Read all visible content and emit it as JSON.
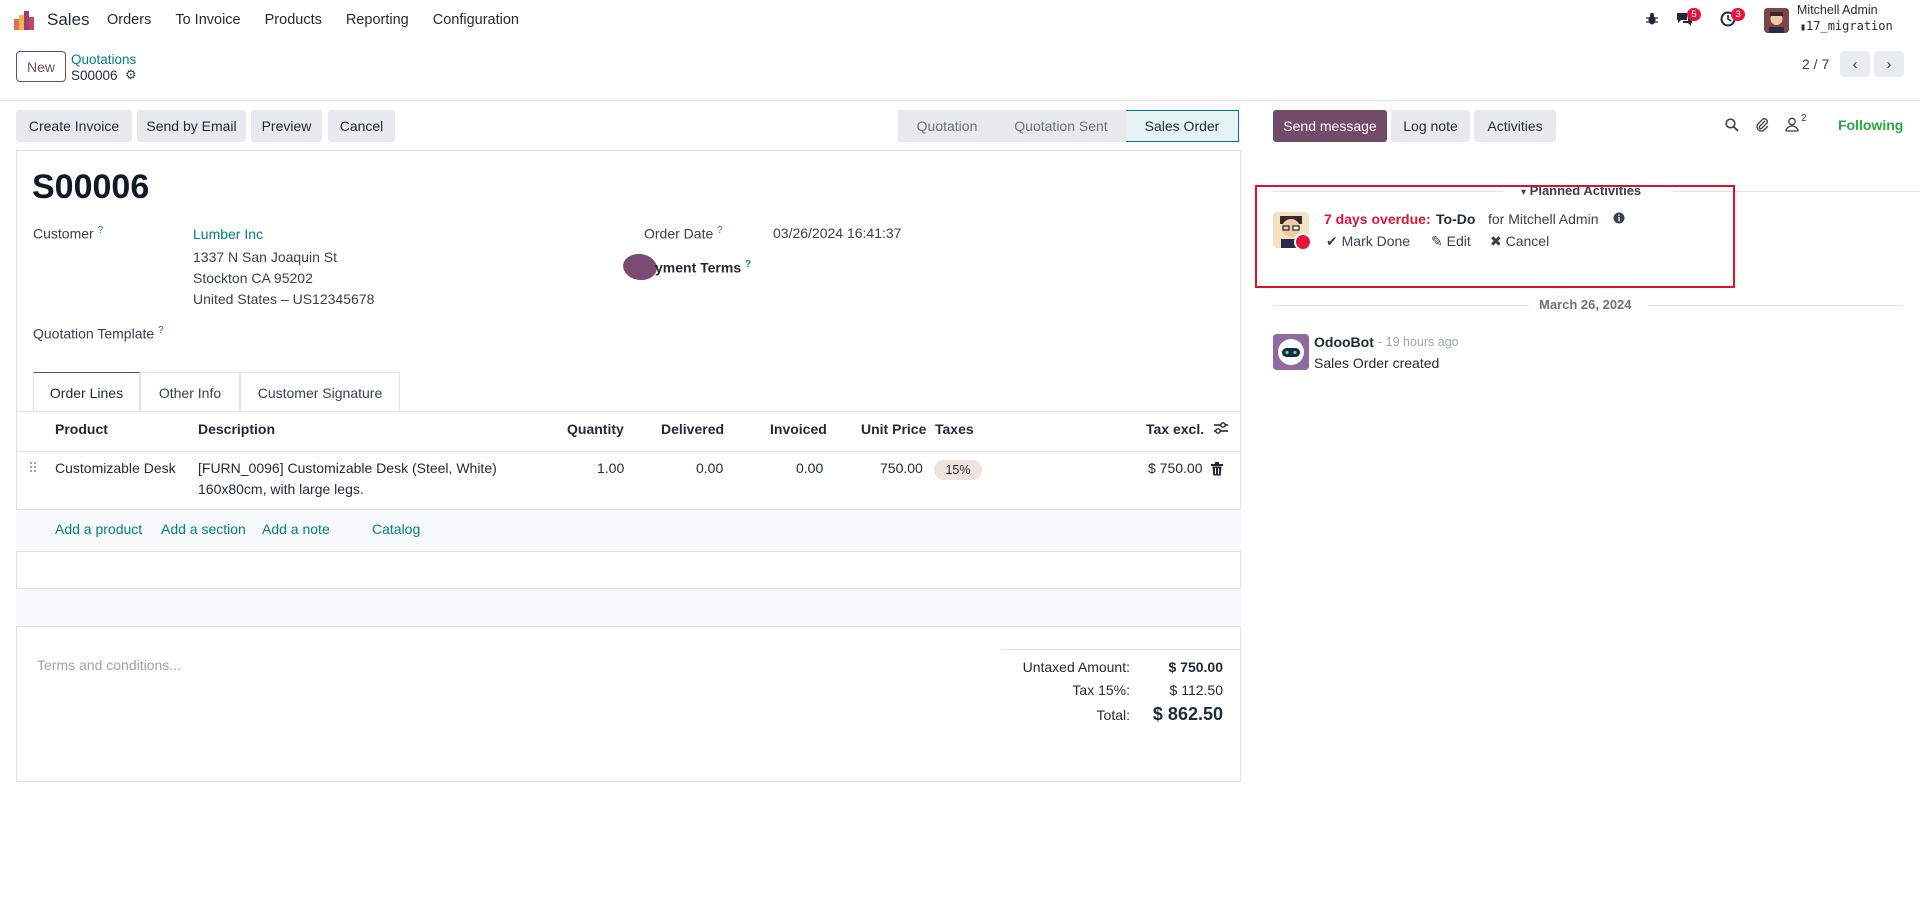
{
  "navbar": {
    "app_name": "Sales",
    "menu": [
      "Orders",
      "To Invoice",
      "Products",
      "Reporting",
      "Configuration"
    ],
    "messages_count": "5",
    "activities_count": "3",
    "user_name": "Mitchell Admin",
    "db_name": "17_migration"
  },
  "control": {
    "new_label": "New",
    "breadcrumb_parent": "Quotations",
    "breadcrumb_current": "S00006",
    "pager": "2 / 7"
  },
  "actions": {
    "create_invoice": "Create Invoice",
    "send_by_email": "Send by Email",
    "preview": "Preview",
    "cancel": "Cancel"
  },
  "status_stages": [
    "Quotation",
    "Quotation Sent",
    "Sales Order"
  ],
  "form": {
    "title": "S00006",
    "customer_label": "Customer",
    "customer_name": "Lumber Inc",
    "address_1": "1337 N San Joaquin St",
    "address_2": "Stockton CA 95202",
    "address_3": "United States – US12345678",
    "template_label": "Quotation Template",
    "order_date_label": "Order Date",
    "order_date_value": "03/26/2024 16:41:37",
    "payment_terms_label": "yment Terms",
    "tooltip_mark": "?"
  },
  "tabs": [
    "Order Lines",
    "Other Info",
    "Customer Signature"
  ],
  "table": {
    "headers": {
      "product": "Product",
      "description": "Description",
      "quantity": "Quantity",
      "delivered": "Delivered",
      "invoiced": "Invoiced",
      "unit_price": "Unit Price",
      "taxes": "Taxes",
      "tax_excl": "Tax excl."
    },
    "rows": [
      {
        "product": "Customizable Desk",
        "description_1": "[FURN_0096] Customizable Desk (Steel, White)",
        "description_2": "160x80cm, with large legs.",
        "quantity": "1.00",
        "delivered": "0.00",
        "invoiced": "0.00",
        "unit_price": "750.00",
        "tax": "15%",
        "subtotal": "$ 750.00"
      }
    ],
    "add_product": "Add a product",
    "add_section": "Add a section",
    "add_note": "Add a note",
    "catalog": "Catalog"
  },
  "terms_placeholder": "Terms and conditions...",
  "totals": {
    "untaxed_label": "Untaxed Amount:",
    "untaxed_value": "$ 750.00",
    "tax_label": "Tax 15%:",
    "tax_value": "$ 112.50",
    "total_label": "Total:",
    "total_value": "$ 862.50"
  },
  "chatter": {
    "send_message": "Send message",
    "log_note": "Log note",
    "activities": "Activities",
    "followers_count": "2",
    "following": "Following",
    "planned_activities": "Planned Activities",
    "overdue": "7 days overdue:",
    "activity_type": "To-Do",
    "activity_for": "for Mitchell Admin",
    "mark_done": "Mark Done",
    "edit": "Edit",
    "cancel": "Cancel",
    "date_separator": "March 26, 2024",
    "message_author": "OdooBot",
    "message_time": "- 19 hours ago",
    "message_body": "Sales Order created"
  },
  "colors": {
    "brand": "#714b67",
    "link": "#017e84",
    "danger": "#e3163b",
    "success": "#28a745"
  }
}
